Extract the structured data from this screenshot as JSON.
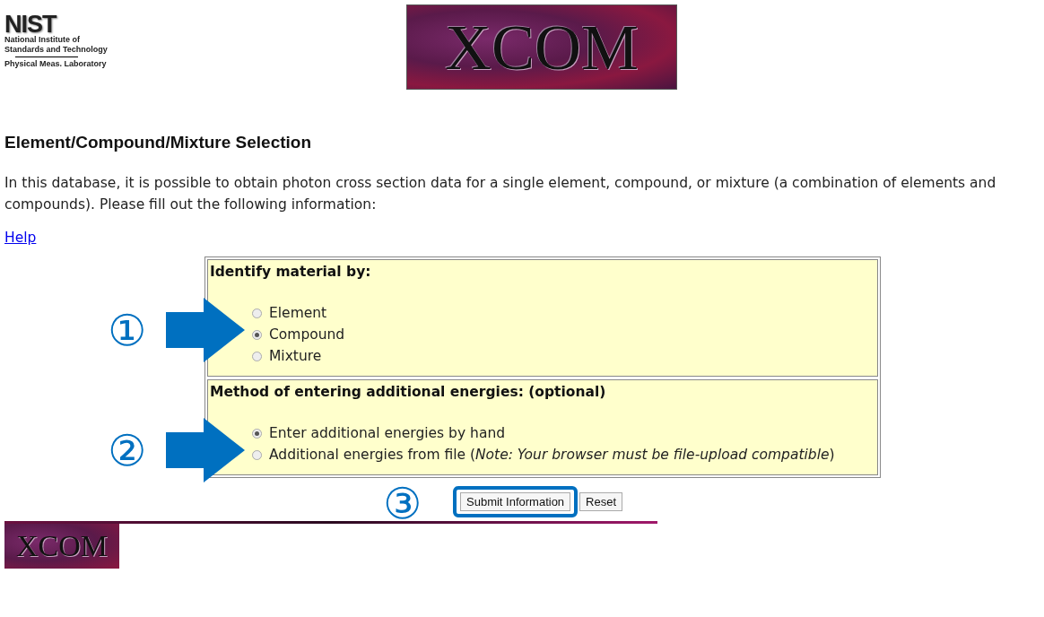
{
  "header": {
    "logo": {
      "mark": "NIST",
      "lines": [
        "National Institute of",
        "Standards and Technology"
      ],
      "lab": "Physical Meas. Laboratory"
    },
    "banner": "XCOM"
  },
  "heading": "Element/Compound/Mixture Selection",
  "intro": "In this database, it is possible to obtain photon cross section data for a single element, compound, or mixture (a combination of elements and compounds). Please fill out the following information:",
  "help_link": "Help",
  "sections": [
    {
      "title": "Identify material by:",
      "marker": "①",
      "options": [
        {
          "label": "Element",
          "selected": false
        },
        {
          "label": "Compound",
          "selected": true
        },
        {
          "label": "Mixture",
          "selected": false
        }
      ]
    },
    {
      "title": "Method of entering additional energies: (optional)",
      "marker": "②",
      "options": [
        {
          "label": "Enter additional energies by hand",
          "selected": true
        },
        {
          "label": "Additional energies from file (*Note: Your browser must be file-upload compatible*)",
          "selected": false
        }
      ]
    }
  ],
  "button_marker": "③",
  "buttons": [
    {
      "label": "Submit Information",
      "highlighted": true
    },
    {
      "label": "Reset",
      "highlighted": false
    }
  ],
  "footer_logo": "XCOM"
}
